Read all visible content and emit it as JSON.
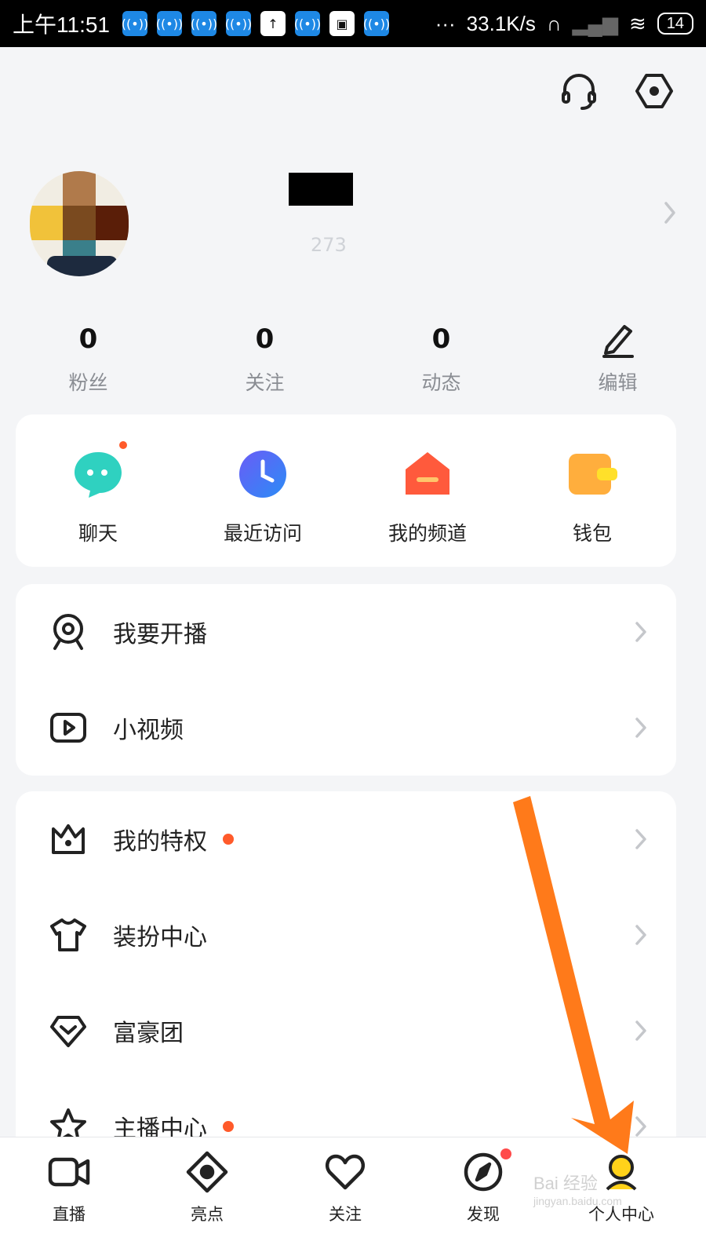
{
  "status_bar": {
    "time": "上午11:51",
    "network_speed": "33.1K/s",
    "battery": "14"
  },
  "header": {
    "icons": [
      "headset-icon",
      "settings-hexagon-icon"
    ]
  },
  "profile": {
    "user_id": "273"
  },
  "stats": [
    {
      "value": "0",
      "label": "粉丝"
    },
    {
      "value": "0",
      "label": "关注"
    },
    {
      "value": "0",
      "label": "动态"
    },
    {
      "label": "编辑",
      "icon": "edit-pen-icon"
    }
  ],
  "quick_actions": [
    {
      "label": "聊天",
      "icon": "chat-bubble-icon",
      "color": "#2fd1c0",
      "badge": true
    },
    {
      "label": "最近访问",
      "icon": "clock-icon",
      "color": "#4a6cf7",
      "badge": false
    },
    {
      "label": "我的频道",
      "icon": "channel-house-icon",
      "color": "#ff5a3c",
      "badge": false
    },
    {
      "label": "钱包",
      "icon": "wallet-icon",
      "color": "#ffb43a",
      "badge": false
    }
  ],
  "menu_group_1": [
    {
      "label": "我要开播",
      "icon": "webcam-icon",
      "badge": false
    },
    {
      "label": "小视频",
      "icon": "play-video-icon",
      "badge": false
    }
  ],
  "menu_group_2": [
    {
      "label": "我的特权",
      "icon": "crown-icon",
      "badge": true
    },
    {
      "label": "装扮中心",
      "icon": "tshirt-icon",
      "badge": false
    },
    {
      "label": "富豪团",
      "icon": "diamond-icon",
      "badge": false
    },
    {
      "label": "主播中心",
      "icon": "star-icon",
      "badge": true
    }
  ],
  "bottom_nav": [
    {
      "label": "直播",
      "icon": "video-camera-icon",
      "active": false,
      "badge": false
    },
    {
      "label": "亮点",
      "icon": "eye-diamond-icon",
      "active": false,
      "badge": false
    },
    {
      "label": "关注",
      "icon": "heart-icon",
      "active": false,
      "badge": false
    },
    {
      "label": "发现",
      "icon": "compass-icon",
      "active": false,
      "badge": true
    },
    {
      "label": "个人中心",
      "icon": "person-icon",
      "active": true,
      "badge": false
    }
  ],
  "watermark": {
    "text": "Bai 经验",
    "subtext": "jingyan.baidu.com"
  },
  "colors": {
    "accent_dot": "#ff5a2a",
    "annotation_arrow": "#ff7a1a",
    "active_tab": "#ffd21a"
  }
}
